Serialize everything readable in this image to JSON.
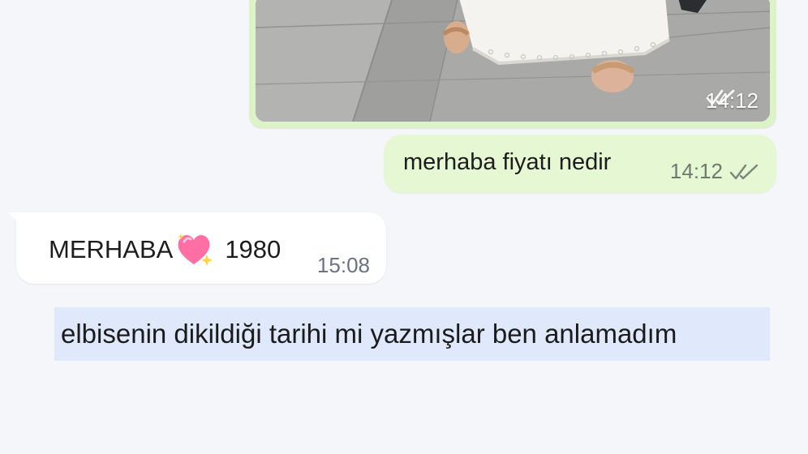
{
  "messages": {
    "image_message": {
      "time": "14:12",
      "status_icon": "double-check-icon"
    },
    "outgoing_text": {
      "text": "merhaba fiyatı nedir",
      "time": "14:12",
      "status_icon": "double-check-icon"
    },
    "incoming_text": {
      "text_before": "MERHABA",
      "emoji": "sparkling-heart-icon",
      "text_after": "1980",
      "time": "15:08"
    }
  },
  "caption": {
    "text": "elbisenin dikildiği tarihi mi yazmışlar ben anlamadım"
  },
  "colors": {
    "outgoing_bubble": "#e5f7d3",
    "image_bubble": "#dcf3c8",
    "incoming_bubble": "#ffffff",
    "background": "#f4f6fa",
    "caption_highlight": "#dfe9fb",
    "heart": "#ff6fa3"
  }
}
